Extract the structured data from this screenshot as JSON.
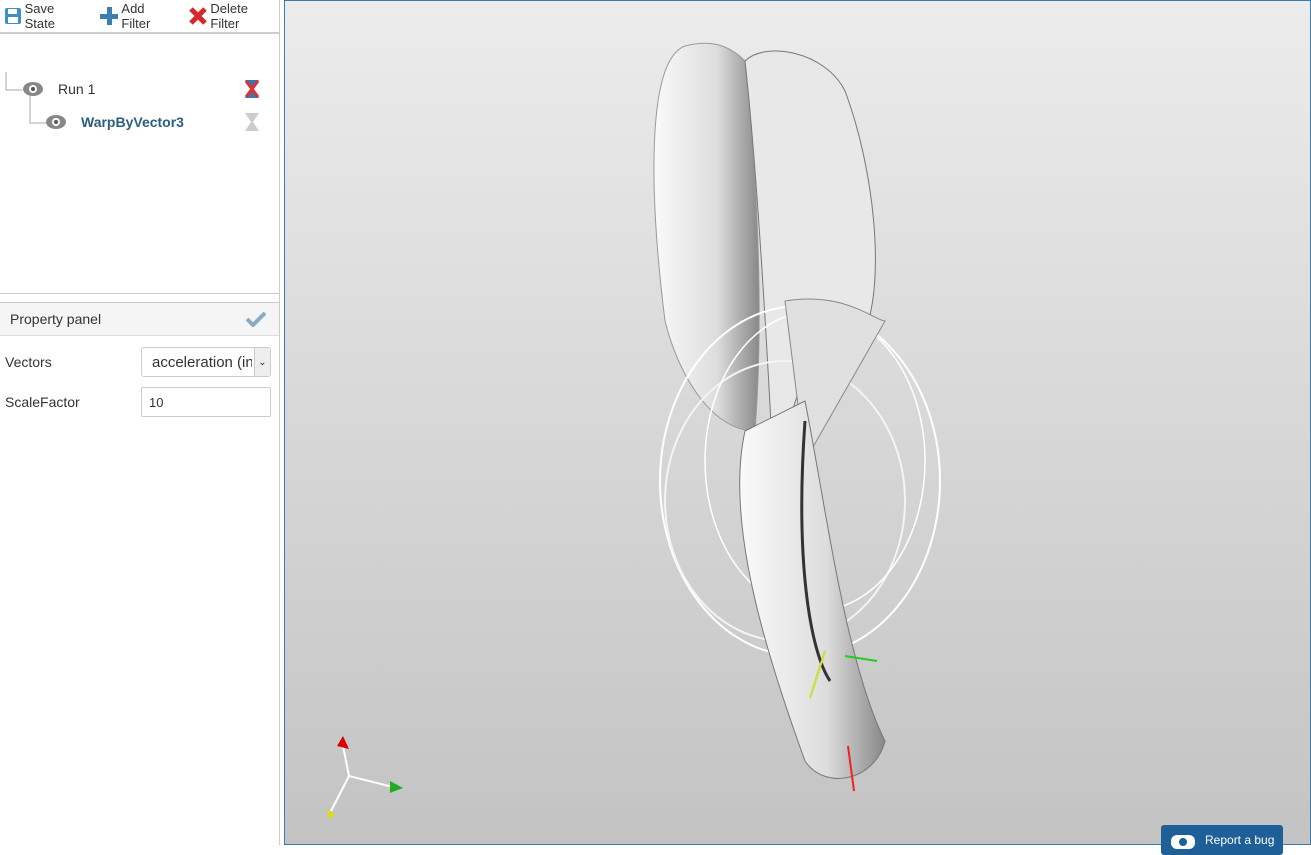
{
  "toolbar": {
    "save": "Save State",
    "add": "Add Filter",
    "delete": "Delete Filter"
  },
  "pipeline": [
    {
      "label": "Run 1"
    },
    {
      "label": "WarpByVector3"
    }
  ],
  "property_panel": {
    "title": "Property panel",
    "fields": [
      {
        "label": "Vectors",
        "value": "acceleration (in"
      },
      {
        "label": "ScaleFactor",
        "value": "10"
      }
    ]
  },
  "report_bug": "Report a bug",
  "colors": {
    "accent": "#1d5f96",
    "link": "#2a5f80"
  }
}
